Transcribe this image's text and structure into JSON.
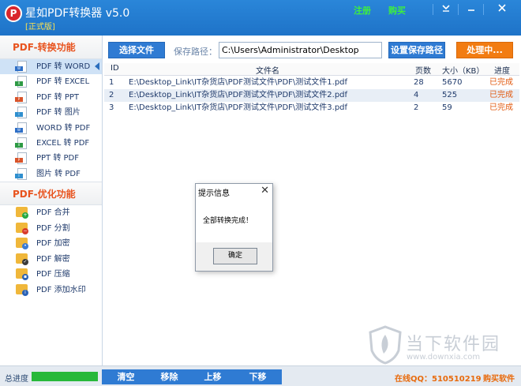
{
  "titlebar": {
    "title": "星如PDF转换器 v5.0",
    "edition": "[正式版]",
    "register": "注册",
    "buy": "购买",
    "dropdown_icon": "chevron-down-icon",
    "minimize_icon": "minimize-icon",
    "close_icon": "close-icon"
  },
  "sidebar": {
    "convert_section": "PDF-转换功能",
    "convert_items": [
      {
        "label": "PDF 转 WORD",
        "tag": "W",
        "color": "#2e6fc7"
      },
      {
        "label": "PDF 转 EXCEL",
        "tag": "X",
        "color": "#2d9a44"
      },
      {
        "label": "PDF 转 PPT",
        "tag": "P",
        "color": "#d9542a"
      },
      {
        "label": "PDF 转 图片",
        "tag": "I",
        "color": "#2f8fcf"
      },
      {
        "label": "WORD 转 PDF",
        "tag": "W",
        "color": "#2e6fc7"
      },
      {
        "label": "EXCEL 转 PDF",
        "tag": "X",
        "color": "#2d9a44"
      },
      {
        "label": "PPT 转 PDF",
        "tag": "P",
        "color": "#d9542a"
      },
      {
        "label": "图片 转 PDF",
        "tag": "I",
        "color": "#2f8fcf"
      }
    ],
    "optimize_section": "PDF-优化功能",
    "optimize_items": [
      {
        "label": "PDF 合并",
        "badge": "+",
        "color": "#27a842"
      },
      {
        "label": "PDF 分割",
        "badge": "−",
        "color": "#d93b2b"
      },
      {
        "label": "PDF 加密",
        "badge": "•",
        "color": "#3a7bd5"
      },
      {
        "label": "PDF 解密",
        "badge": "✓",
        "color": "#3a3a3a"
      },
      {
        "label": "PDF 压缩",
        "badge": "▪",
        "color": "#2a62b6"
      },
      {
        "label": "PDF 添加水印",
        "badge": "i",
        "color": "#2a62b6"
      }
    ]
  },
  "toolbar": {
    "select_file": "选择文件",
    "path_label": "保存路径：",
    "path_value": "C:\\Users\\Administrator\\Desktop",
    "set_path": "设置保存路径",
    "process": "处理中..."
  },
  "table": {
    "headers": {
      "id": "ID",
      "name": "文件名",
      "pages": "页数",
      "size": "大小（KB）",
      "progress": "进度"
    },
    "rows": [
      {
        "id": "1",
        "name": "E:\\Desktop_Link\\IT杂货店\\PDF测试文件\\PDF\\测试文件1.pdf",
        "pages": "28",
        "size": "5670",
        "progress": "已完成"
      },
      {
        "id": "2",
        "name": "E:\\Desktop_Link\\IT杂货店\\PDF测试文件\\PDF\\测试文件2.pdf",
        "pages": "4",
        "size": "525",
        "progress": "已完成"
      },
      {
        "id": "3",
        "name": "E:\\Desktop_Link\\IT杂货店\\PDF测试文件\\PDF\\测试文件3.pdf",
        "pages": "2",
        "size": "59",
        "progress": "已完成"
      }
    ]
  },
  "dialog": {
    "title": "提示信息",
    "message": "全部转换完成！",
    "ok": "确定"
  },
  "watermark": {
    "text": "当下软件园",
    "sub": "www.downxia.com"
  },
  "statusbar": {
    "progress_label": "总进度",
    "progress_fraction": 1.0,
    "clear": "清空",
    "remove": "移除",
    "move_up": "上移",
    "move_down": "下移",
    "qq": "在线QQ：510510219",
    "buy_software": "购买软件"
  }
}
